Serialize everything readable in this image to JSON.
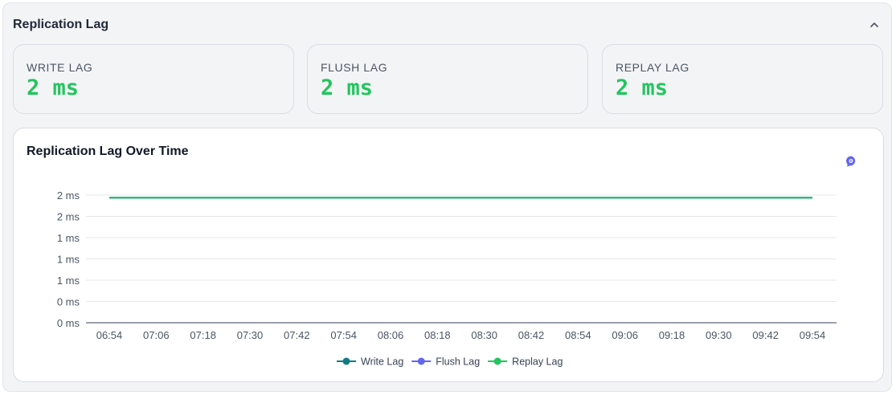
{
  "panel": {
    "title": "Replication Lag",
    "collapse_icon": "chevron-up-icon"
  },
  "stats": [
    {
      "label": "WRITE LAG",
      "value": "2 ms"
    },
    {
      "label": "FLUSH LAG",
      "value": "2 ms"
    },
    {
      "label": "REPLAY LAG",
      "value": "2 ms"
    }
  ],
  "colors": {
    "value_green": "#22c55e",
    "write": "#0e7c86",
    "flush": "#6366f1",
    "replay": "#22c55e",
    "ai_icon": "#6366f1"
  },
  "chart": {
    "title": "Replication Lag Over Time",
    "ai_icon": "ai-assistant-icon"
  },
  "chart_data": {
    "type": "line",
    "title": "Replication Lag Over Time",
    "xlabel": "",
    "ylabel": "",
    "grid": true,
    "legend_position": "bottom",
    "y_tick_labels": [
      "0 ms",
      "0 ms",
      "1 ms",
      "1 ms",
      "1 ms",
      "2 ms",
      "2 ms"
    ],
    "x_tick_labels": [
      "06:54",
      "07:06",
      "07:18",
      "07:30",
      "07:42",
      "07:54",
      "08:06",
      "08:18",
      "08:30",
      "08:42",
      "08:54",
      "09:06",
      "09:18",
      "09:30",
      "09:42",
      "09:54"
    ],
    "ylim": [
      0,
      2.4
    ],
    "x_range": [
      "06:54",
      "09:54"
    ],
    "series": [
      {
        "name": "Write Lag",
        "color": "#0e7c86",
        "values": [
          2.35,
          2.35
        ]
      },
      {
        "name": "Flush Lag",
        "color": "#6366f1",
        "values": [
          2.35,
          2.35
        ]
      },
      {
        "name": "Replay Lag",
        "color": "#22c55e",
        "values": [
          2.35,
          2.35
        ]
      }
    ]
  }
}
